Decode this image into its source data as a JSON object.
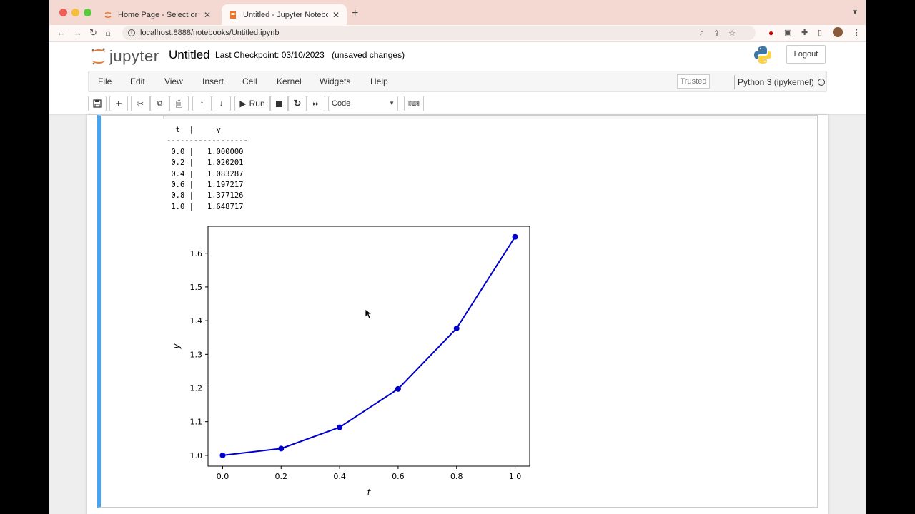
{
  "browser": {
    "tabs": [
      {
        "title": "Home Page - Select or create a notebook",
        "active": false
      },
      {
        "title": "Untitled - Jupyter Notebook",
        "active": true
      }
    ],
    "url": "localhost:8888/notebooks/Untitled.ipynb"
  },
  "jupyter": {
    "logo_text": "jupyter",
    "notebook_name": "Untitled",
    "checkpoint": "Last Checkpoint: 03/10/2023",
    "unsaved": "(unsaved changes)",
    "logout_label": "Logout",
    "menu": [
      "File",
      "Edit",
      "View",
      "Insert",
      "Cell",
      "Kernel",
      "Widgets",
      "Help"
    ],
    "trusted_label": "Trusted",
    "kernel_name": "Python 3 (ipykernel)",
    "run_label": "Run",
    "cell_type": "Code"
  },
  "output": {
    "table_text": "  t  |     y\n------------------\n 0.0 |   1.000000\n 0.2 |   1.020201\n 0.4 |   1.083287\n 0.6 |   1.197217\n 0.8 |   1.377126\n 1.0 |   1.648717"
  },
  "chart_data": {
    "type": "line",
    "x": [
      0.0,
      0.2,
      0.4,
      0.6,
      0.8,
      1.0
    ],
    "series": [
      {
        "values": [
          1.0,
          1.020201,
          1.083287,
          1.197217,
          1.377126,
          1.648717
        ],
        "color": "#0000cc",
        "marker": "o"
      }
    ],
    "xlabel": "t",
    "ylabel": "y",
    "xticks": [
      "0.0",
      "0.2",
      "0.4",
      "0.6",
      "0.8",
      "1.0"
    ],
    "yticks": [
      "1.0",
      "1.1",
      "1.2",
      "1.3",
      "1.4",
      "1.5",
      "1.6"
    ],
    "xlim": [
      -0.05,
      1.05
    ],
    "ylim": [
      0.968,
      1.68
    ],
    "grid": false
  }
}
